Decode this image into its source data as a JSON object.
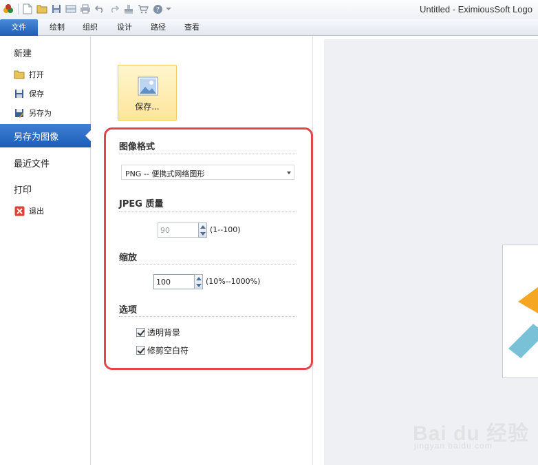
{
  "window": {
    "title": "Untitled - EximiousSoft Logo"
  },
  "tabs": [
    "文件",
    "绘制",
    "组织",
    "设计",
    "路径",
    "查看"
  ],
  "nav": {
    "new": "新建",
    "open": "打开",
    "save": "保存",
    "save_as": "另存为",
    "save_as_image": "另存为图像",
    "recent": "最近文件",
    "print": "打印",
    "exit": "退出"
  },
  "panel": {
    "save_button": "保存...",
    "image_format": {
      "heading": "图像格式",
      "selected": "PNG -- 便携式网络图形"
    },
    "jpeg_quality": {
      "heading": "JPEG 质量",
      "value": "90",
      "range": "(1--100)"
    },
    "scale": {
      "heading": "缩放",
      "value": "100",
      "range": "(10%--1000%)"
    },
    "options": {
      "heading": "选项",
      "transparent_bg": "透明背景",
      "trim_whitespace": "修剪空白符"
    }
  },
  "watermark": {
    "brand": "Bai du 经验",
    "url": "jingyan.baidu.com"
  },
  "colors": {
    "accent": "#1e5db8",
    "highlight_frame": "#e0474c",
    "save_btn": "#fde59a"
  }
}
